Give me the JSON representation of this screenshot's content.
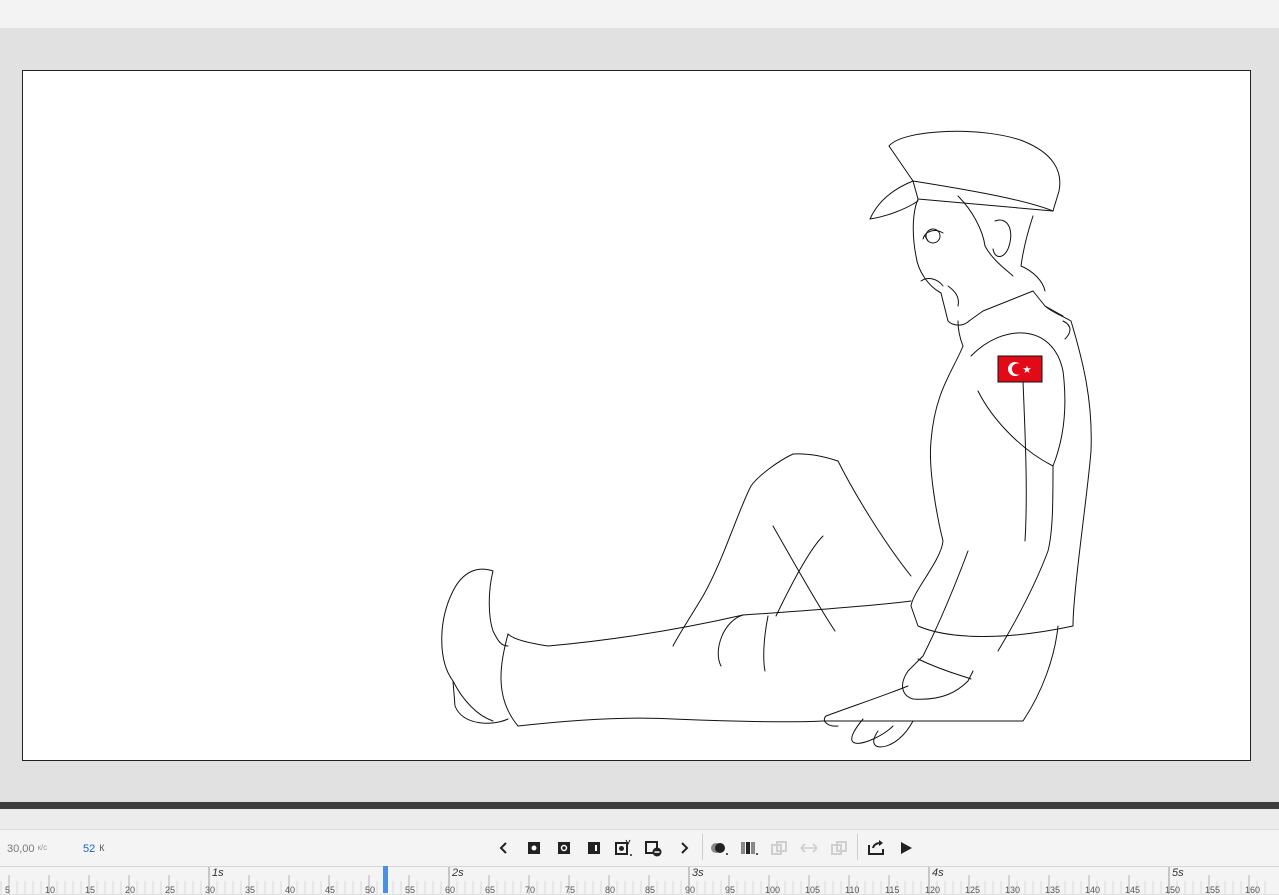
{
  "timeline": {
    "fps_value": "30,00",
    "fps_unit": "к/с",
    "current_frame": "52",
    "frame_unit": "К"
  },
  "ruler": {
    "second_labels": [
      "1s",
      "2s",
      "3s",
      "4s",
      "5s"
    ],
    "frame_numbers": [
      "5",
      "10",
      "15",
      "20",
      "25",
      "30",
      "35",
      "40",
      "45",
      "50",
      "55",
      "60",
      "65",
      "70",
      "75",
      "80",
      "85",
      "90",
      "95",
      "100",
      "105",
      "110",
      "115",
      "120",
      "125",
      "130",
      "135",
      "140",
      "145",
      "150",
      "155",
      "160"
    ],
    "playhead_frame": 52
  },
  "toolbar_icons": [
    "prev-keyframe-icon",
    "insert-keyframe-icon",
    "insert-blank-keyframe-icon",
    "insert-frame-icon",
    "tween-icon",
    "remove-keyframe-icon",
    "next-keyframe-icon",
    "onion-skin-icon",
    "onion-skin-outlines-icon",
    "edit-multiple-frames-icon",
    "loop-icon",
    "sync-icon",
    "export-icon",
    "play-icon"
  ],
  "colors": {
    "playhead": "#4a90e2",
    "flag_red": "#e30a17",
    "frame_number": "#1565c0"
  }
}
